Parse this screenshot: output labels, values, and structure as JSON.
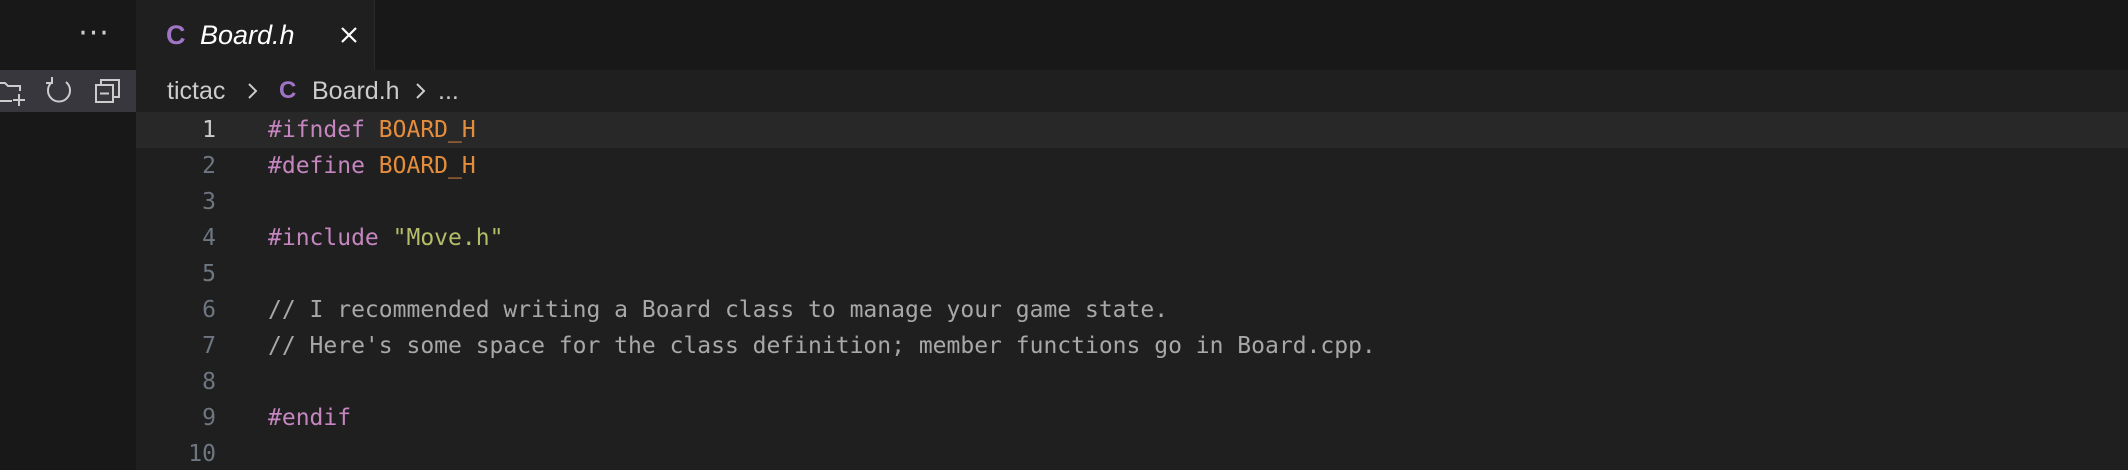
{
  "sidebar": {
    "more_label": "···",
    "toolbar": {
      "icons": [
        "new-folder-icon",
        "refresh-icon",
        "collapse-all-icon"
      ]
    }
  },
  "tab": {
    "icon_glyph": "C",
    "label": "Board.h"
  },
  "breadcrumb": {
    "folder": "tictac",
    "file_icon_glyph": "C",
    "file": "Board.h",
    "symbol": "..."
  },
  "editor": {
    "current_line": 1,
    "lines": [
      {
        "number": "1",
        "directive": "#ifndef",
        "space": " ",
        "arg": "BOARD_H",
        "arg_kind": "macro"
      },
      {
        "number": "2",
        "directive": "#define",
        "space": " ",
        "arg": "BOARD_H",
        "arg_kind": "macro"
      },
      {
        "number": "3",
        "text": ""
      },
      {
        "number": "4",
        "directive": "#include",
        "space": " ",
        "arg": "\"Move.h\"",
        "arg_kind": "string"
      },
      {
        "number": "5",
        "text": ""
      },
      {
        "number": "6",
        "comment": "// I recommended writing a Board class to manage your game state."
      },
      {
        "number": "7",
        "comment": "// Here's some space for the class definition; member functions go in Board.cpp."
      },
      {
        "number": "8",
        "text": ""
      },
      {
        "number": "9",
        "directive": "#endif"
      },
      {
        "number": "10",
        "text": ""
      }
    ]
  },
  "colors": {
    "directive": "#c586c0",
    "macro": "#e48d3c",
    "include_string": "#b5bd68",
    "comment": "#a8a8a8",
    "c_file_icon": "#a074c4"
  }
}
